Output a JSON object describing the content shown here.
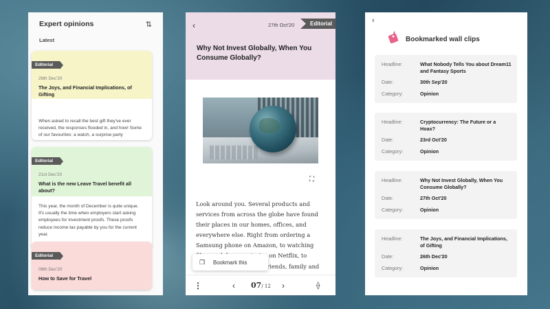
{
  "panel1": {
    "title": "Expert opinions",
    "sort_icon": "sort-arrows-icon",
    "subtitle": "Latest",
    "cards": [
      {
        "tag": "Editorial",
        "date": "26th Dec'20",
        "title": "The Joys, and Financial Implications, of Gifting",
        "body": "When asked to recall the best gift they've ever received, the responses flooded in, and how! Some of our favourites: a watch, a surprise party",
        "color": "#f7f5c8"
      },
      {
        "tag": "Editorial",
        "date": "21st Dec'20",
        "title": "What is the new Leave Travel benefit all about?",
        "body": "This year, the month of December is quite unique. It's usually the time when employers start asking employees for investment proofs. These proofs reduce income tax payable by you for the current year.",
        "color": "#e0f5d8"
      },
      {
        "tag": "Editorial",
        "date": "08th Dec'20",
        "title": "How to Save for Travel",
        "body": "",
        "color": "#fbdada"
      }
    ]
  },
  "panel2": {
    "date": "27th Oct'20",
    "tag": "Editorial",
    "title": "Why Not Invest Globally, When You Consume Globally?",
    "body": "Look around you. Several products and services from across the globe have found their places in our homes, offices, and everywhere else. Right from ordering a Samsung phone on Amazon, to watching films and documentaries on Netflix, to staying connected with friends, family and colleagues through WhatsApp, businesses across the globe thrive to serve consumers around the world. We're global.",
    "bookmark_label": "Bookmark this",
    "page_current": "07",
    "page_total": "/ 12",
    "header_color": "#ecdce8"
  },
  "panel3": {
    "title": "Bookmarked wall clips",
    "keys": {
      "headline": "Headline:",
      "date": "Date:",
      "category": "Category:"
    },
    "items": [
      {
        "headline": "What Nobody Tells You about Dream11 and Fantasy Sports",
        "date": "30th Sep'20",
        "category": "Opinion"
      },
      {
        "headline": "Cryptocurrency: The Future or a Hoax?",
        "date": "23rd Oct'20",
        "category": "Opinion"
      },
      {
        "headline": "Why Not Invest Globally, When You Consume Globally?",
        "date": "27th Oct'20",
        "category": "Opinion"
      },
      {
        "headline": "The Joys, and Financial Implications, of Gifting",
        "date": "26th Dec'20",
        "category": "Opinion"
      }
    ]
  }
}
